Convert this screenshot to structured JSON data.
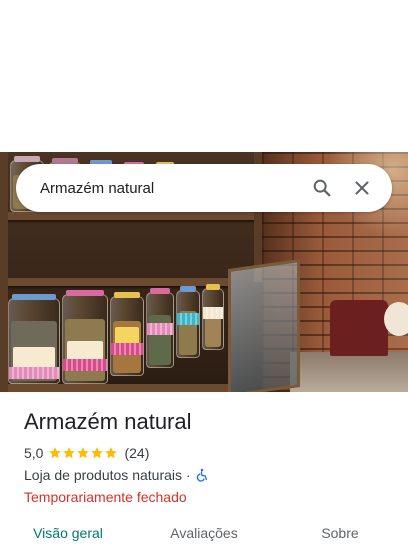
{
  "search": {
    "query": "Armazém natural"
  },
  "place": {
    "title": "Armazém natural",
    "rating": "5,0",
    "stars_filled": 5,
    "review_count": "(24)",
    "category": "Loja de produtos naturais",
    "separator": "·",
    "status": "Temporariamente fechado"
  },
  "tabs": [
    {
      "label": "Visão geral",
      "active": true
    },
    {
      "label": "Avaliações",
      "active": false
    },
    {
      "label": "Sobre",
      "active": false
    }
  ],
  "icons": {
    "search": "search-icon",
    "close": "close-icon",
    "star": "star-icon",
    "accessibility": "wheelchair-icon"
  },
  "colors": {
    "star": "#fbbc04",
    "status_closed": "#d93025",
    "active_tab": "#00796b",
    "icon": "#5f6368",
    "accessibility_icon": "#1a73e8"
  }
}
